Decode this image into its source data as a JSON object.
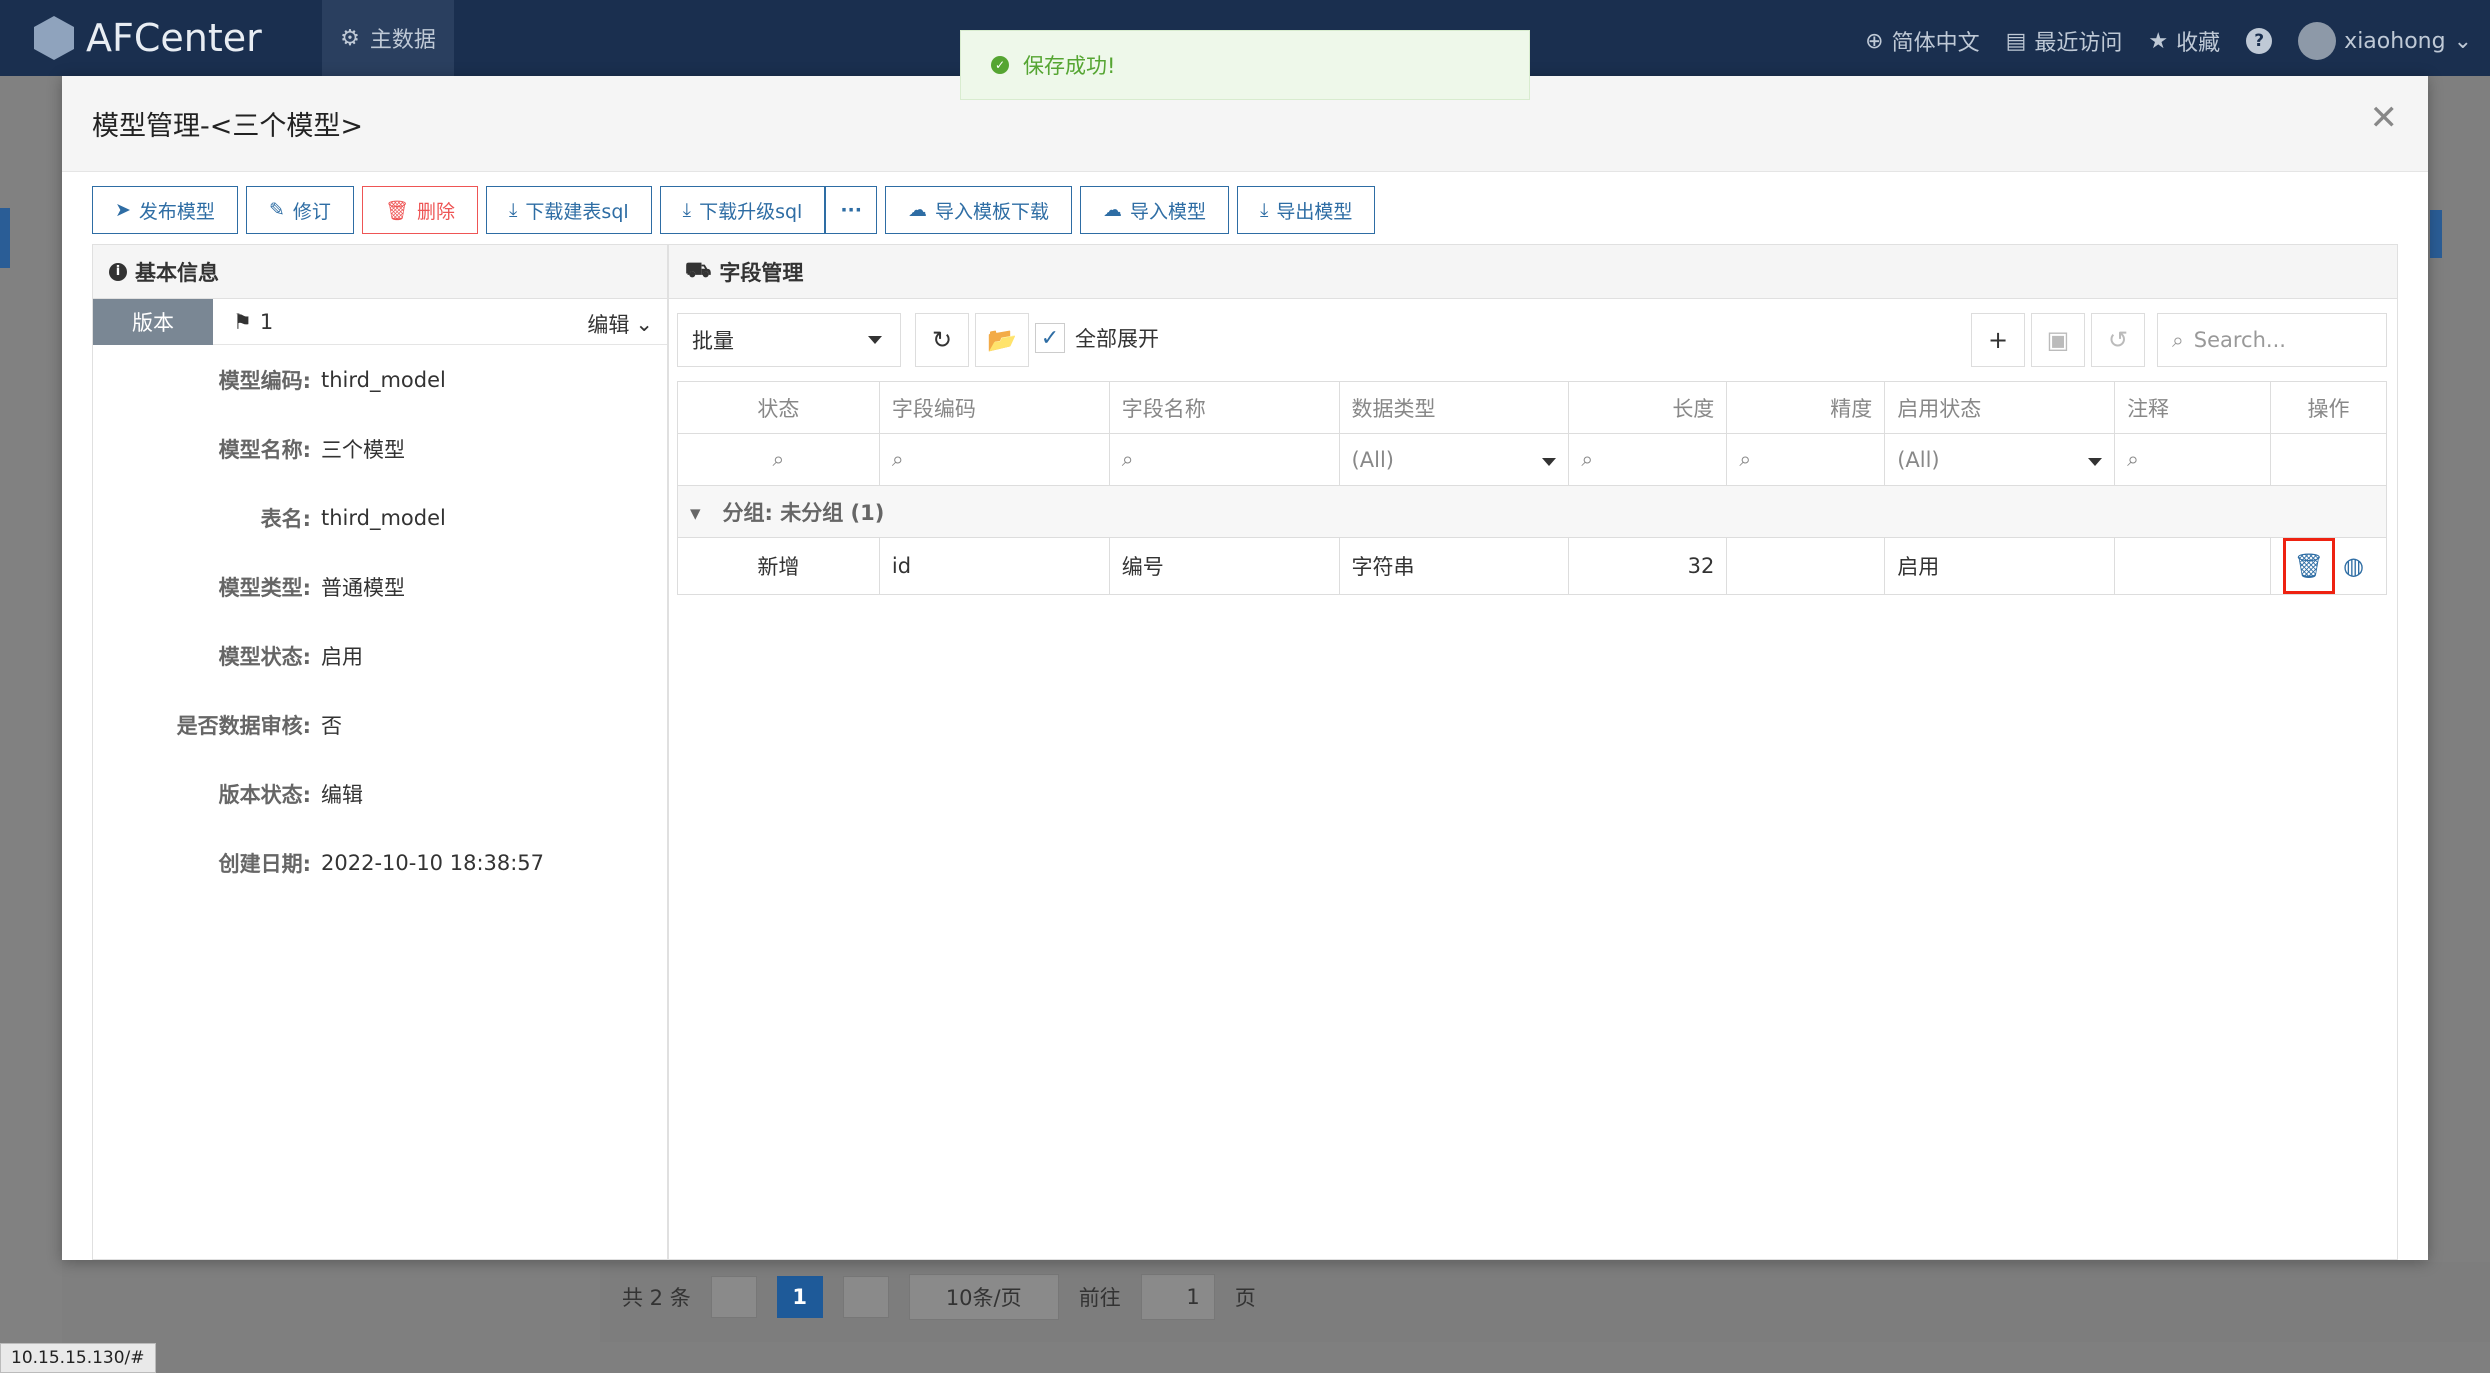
{
  "app": {
    "logo_text": "AFCenter",
    "nav_tab": "主数据",
    "language": "简体中文",
    "recent": "最近访问",
    "favorites": "收藏",
    "help": "?",
    "username": "xiaohong"
  },
  "toast": {
    "message": "保存成功!"
  },
  "modal": {
    "title": "模型管理-<三个模型>",
    "toolbar": {
      "publish": "发布模型",
      "revise": "修订",
      "delete": "删除",
      "download_create_sql": "下载建表sql",
      "download_upgrade_sql": "下载升级sql",
      "more": "···",
      "download_template": "导入模板下载",
      "import_model": "导入模型",
      "export_model": "导出模型"
    },
    "basic_info": {
      "title": "基本信息",
      "version_tab": "版本",
      "version_number": "1",
      "edit_label": "编辑",
      "fields": [
        {
          "label": "模型编码:",
          "value": "third_model"
        },
        {
          "label": "模型名称:",
          "value": "三个模型"
        },
        {
          "label": "表名:",
          "value": "third_model"
        },
        {
          "label": "模型类型:",
          "value": "普通模型"
        },
        {
          "label": "模型状态:",
          "value": "启用"
        },
        {
          "label": "是否数据审核:",
          "value": "否"
        },
        {
          "label": "版本状态:",
          "value": "编辑"
        },
        {
          "label": "创建日期:",
          "value": "2022-10-10 18:38:57"
        }
      ]
    },
    "field_mgmt": {
      "title": "字段管理",
      "batch_select": "批量",
      "expand_all": "全部展开",
      "search_placeholder": "Search...",
      "columns": [
        "状态",
        "字段编码",
        "字段名称",
        "数据类型",
        "长度",
        "精度",
        "启用状态",
        "注释",
        "操作"
      ],
      "filter_all": "(All)",
      "group_label": "分组: 未分组 (1)",
      "rows": [
        {
          "status": "新增",
          "code": "id",
          "name": "编号",
          "type": "字符串",
          "length": "32",
          "precision": "",
          "enabled": "启用",
          "comment": ""
        }
      ]
    }
  },
  "pager": {
    "total": "共 2 条",
    "current": "1",
    "page_size": "10条/页",
    "goto_prefix": "前往",
    "goto_value": "1",
    "goto_suffix": "页"
  },
  "status_url": "10.15.15.130/#"
}
